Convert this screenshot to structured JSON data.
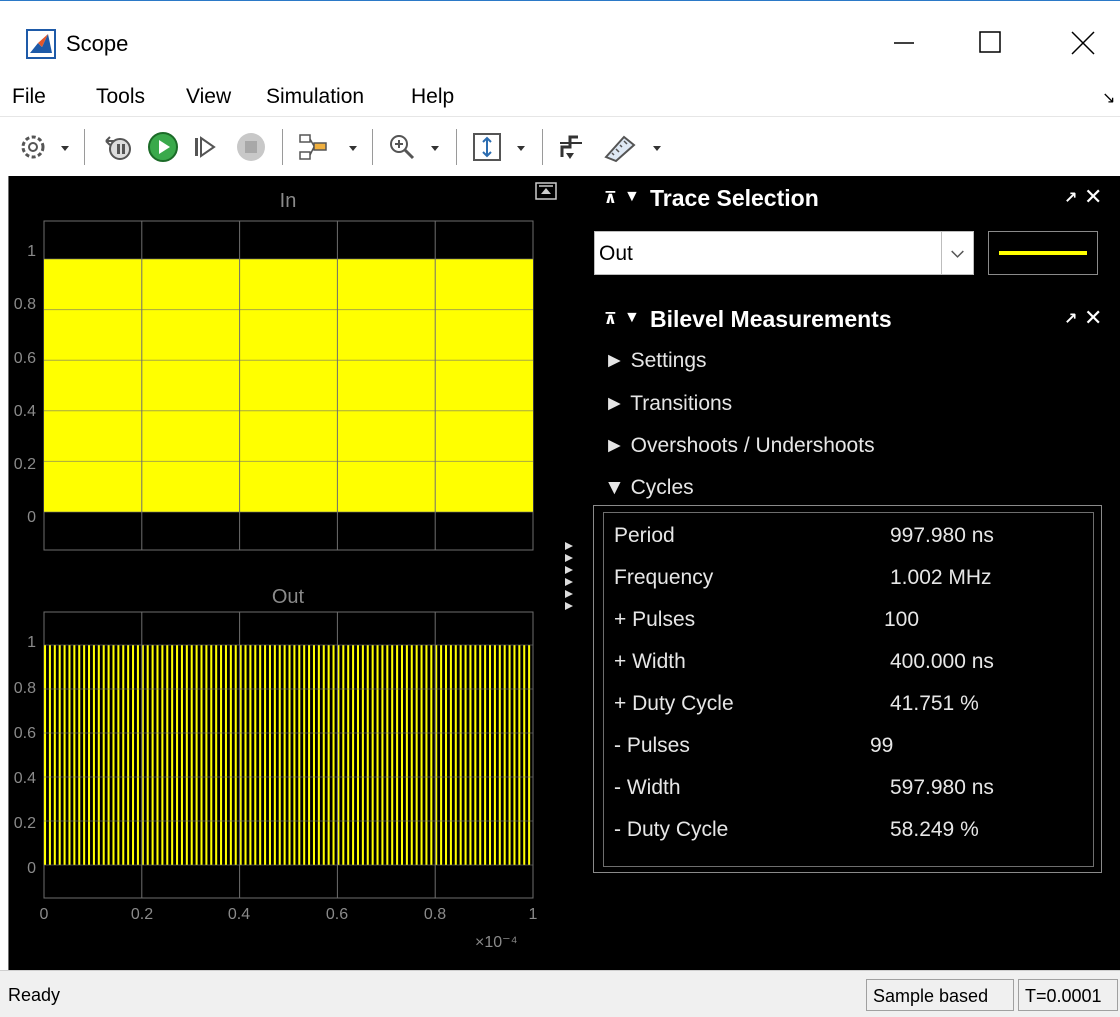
{
  "window": {
    "title": "Scope"
  },
  "menu": [
    "File",
    "Tools",
    "View",
    "Simulation",
    "Help"
  ],
  "toolbar": {
    "icons": [
      "settings-icon",
      "dropdown-arrow-icon",
      "step-back-icon",
      "run-icon",
      "step-forward-icon",
      "stop-icon",
      "signal-selection-icon",
      "zoom-in-icon",
      "scale-axes-icon",
      "triggers-icon",
      "measurement-icon"
    ]
  },
  "colors": {
    "signal": "#ffff00",
    "axes_bg": "#000000",
    "frame_bg": "#000000",
    "grid": "#6e6e6e",
    "text": "#8a8a8a"
  },
  "plots": {
    "in": {
      "title": "In"
    },
    "out": {
      "title": "Out"
    },
    "y_ticks": [
      "1",
      "0.8",
      "0.6",
      "0.4",
      "0.2",
      "0"
    ],
    "x_ticks": [
      "0",
      "0.2",
      "0.4",
      "0.6",
      "0.8",
      "1"
    ],
    "x_exponent": "×10⁻⁴"
  },
  "chart_data": [
    {
      "type": "line",
      "title": "In",
      "xlim": [
        0,
        0.0001
      ],
      "ylim": [
        -0.15,
        1.15
      ],
      "y_ticks": [
        0,
        0.2,
        0.4,
        0.6,
        0.8,
        1
      ],
      "series": [
        {
          "signal": "square wave",
          "low": 0,
          "high": 1
        }
      ]
    },
    {
      "type": "line",
      "title": "Out",
      "xlim": [
        0,
        0.0001
      ],
      "ylim": [
        -0.15,
        1.15
      ],
      "y_ticks": [
        0,
        0.2,
        0.4,
        0.6,
        0.8,
        1
      ],
      "x_ticks": [
        0,
        0.2,
        0.4,
        0.6,
        0.8,
        1
      ],
      "series": [
        {
          "signal": "pulse train",
          "low": 0,
          "high": 1,
          "pulses": 100,
          "duty_cycle_percent": 41.751
        }
      ]
    }
  ],
  "trace_selection": {
    "title": "Trace Selection",
    "selected": "Out",
    "line_color": "#ffff00"
  },
  "bilevel": {
    "title": "Bilevel Measurements",
    "sections": {
      "settings": "Settings",
      "transitions": "Transitions",
      "overshoots": "Overshoots / Undershoots",
      "cycles": "Cycles"
    },
    "cycles": [
      {
        "label": "Period",
        "value": "997.980 ns"
      },
      {
        "label": "Frequency",
        "value": "1.002 MHz"
      },
      {
        "label": "+ Pulses",
        "value": "100"
      },
      {
        "label": "+ Width",
        "value": "400.000 ns"
      },
      {
        "label": "+ Duty Cycle",
        "value": "41.751 %"
      },
      {
        "label": "- Pulses",
        "value": "99"
      },
      {
        "label": "- Width",
        "value": "597.980 ns"
      },
      {
        "label": "- Duty Cycle",
        "value": "58.249 %"
      }
    ]
  },
  "status": {
    "text": "Ready",
    "mode": "Sample based",
    "time": "T=0.0001"
  }
}
